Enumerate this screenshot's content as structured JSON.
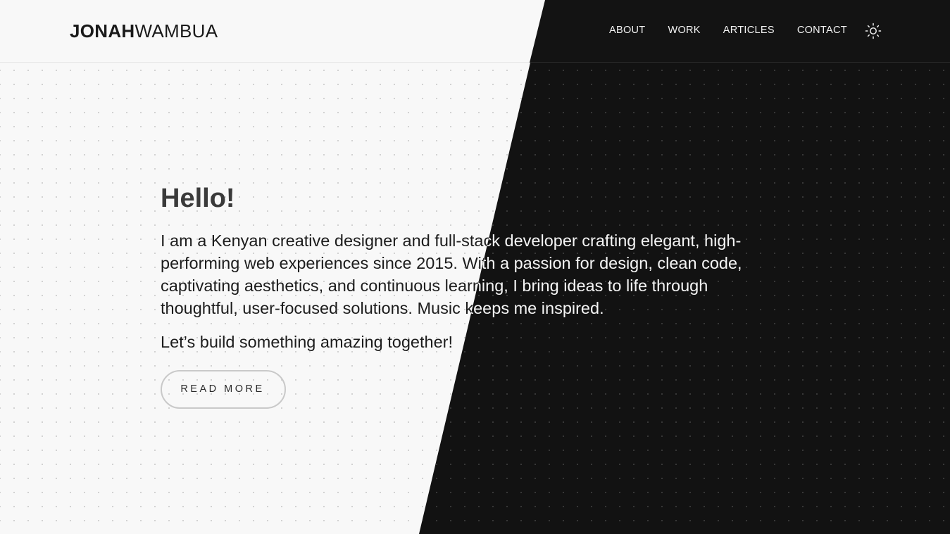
{
  "brand": {
    "first": "JONAH",
    "last": "WAMBUA"
  },
  "nav": {
    "items": [
      "ABOUT",
      "WORK",
      "ARTICLES",
      "CONTACT"
    ],
    "theme_toggle_icon": "sun-icon"
  },
  "hero": {
    "heading": "Hello!",
    "intro": "I am a Kenyan creative designer and full-stack developer crafting elegant, high-performing web experiences since 2015. With a passion for design, clean code, captivating aesthetics, and continuous learning, I bring ideas to life through thoughtful, user-focused solutions. Music keeps me inspired.",
    "tagline": "Let’s build something amazing together!",
    "button_label": "READ MORE"
  },
  "colors": {
    "light_bg": "#f8f8f8",
    "dark_bg": "#121212",
    "text_dark": "#1c1c1c",
    "text_light": "#f4f4f4"
  }
}
